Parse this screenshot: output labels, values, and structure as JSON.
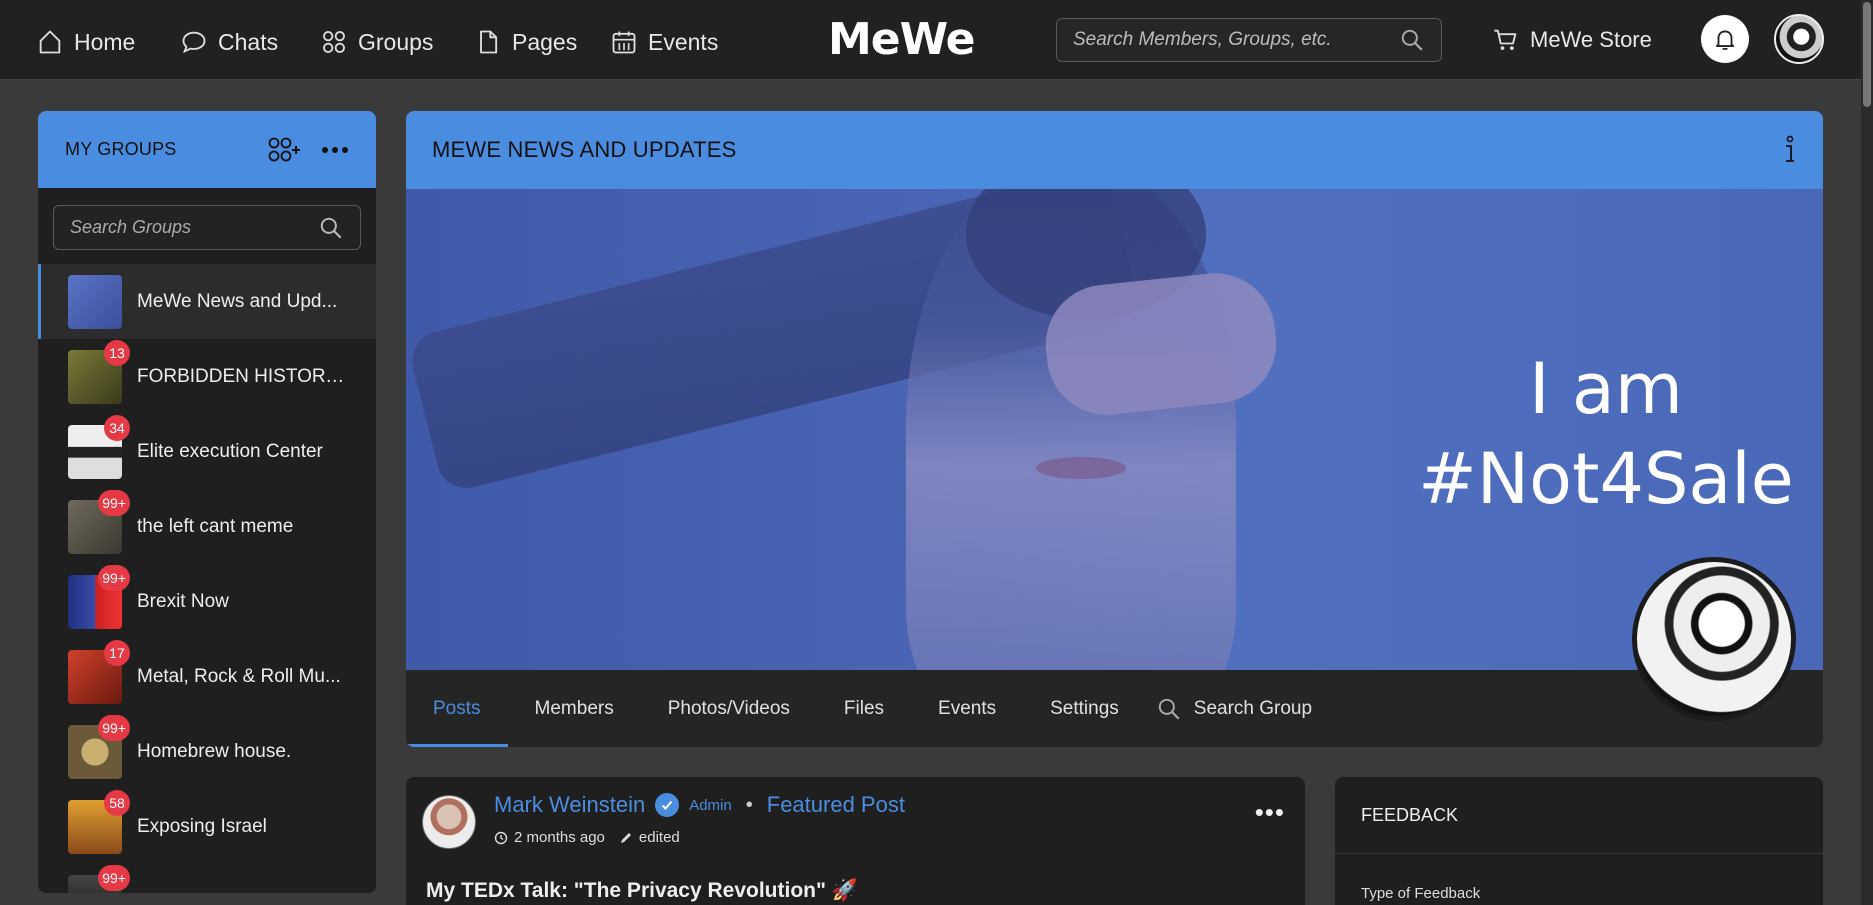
{
  "nav": {
    "home": "Home",
    "chats": "Chats",
    "groups": "Groups",
    "pages": "Pages",
    "events": "Events",
    "logo": "MeWe",
    "search_placeholder": "Search Members, Groups, etc.",
    "store": "MeWe Store"
  },
  "sidebar": {
    "title": "MY GROUPS",
    "search_placeholder": "Search Groups",
    "groups": [
      {
        "name": "MeWe News and Upd...",
        "badge": "",
        "color": "#4a66b6"
      },
      {
        "name": "FORBIDDEN HISTORY ...",
        "badge": "13",
        "color": "#6b6a3a"
      },
      {
        "name": "Elite execution Center",
        "badge": "34",
        "color": "#d9d9d9"
      },
      {
        "name": "the left cant meme",
        "badge": "99+",
        "color": "#5c5a52"
      },
      {
        "name": "Brexit Now",
        "badge": "99+",
        "color": "#2a3b8a"
      },
      {
        "name": "Metal, Rock & Roll Mu...",
        "badge": "17",
        "color": "#b0301c"
      },
      {
        "name": "Homebrew house.",
        "badge": "99+",
        "color": "#8a7a4a"
      },
      {
        "name": "Exposing Israel",
        "badge": "58",
        "color": "#c88a2a"
      },
      {
        "name": "",
        "badge": "99+",
        "color": "#2a2a2a"
      }
    ]
  },
  "group": {
    "title": "MEWE NEWS AND UPDATES",
    "tagline_line1": "I am",
    "tagline_line2": "#Not4Sale",
    "tabs": [
      "Posts",
      "Members",
      "Photos/Videos",
      "Files",
      "Events",
      "Settings"
    ],
    "search_label": "Search Group"
  },
  "post": {
    "author": "Mark Weinstein",
    "role": "Admin",
    "featured": "Featured Post",
    "time": "2 months ago",
    "edited": "edited",
    "title": "My TEDx Talk: \"The Privacy Revolution\" 🚀"
  },
  "feedback": {
    "title": "FEEDBACK",
    "type_label": "Type of Feedback"
  },
  "colors": {
    "accent": "#4a8de0",
    "badge": "#e63946"
  }
}
